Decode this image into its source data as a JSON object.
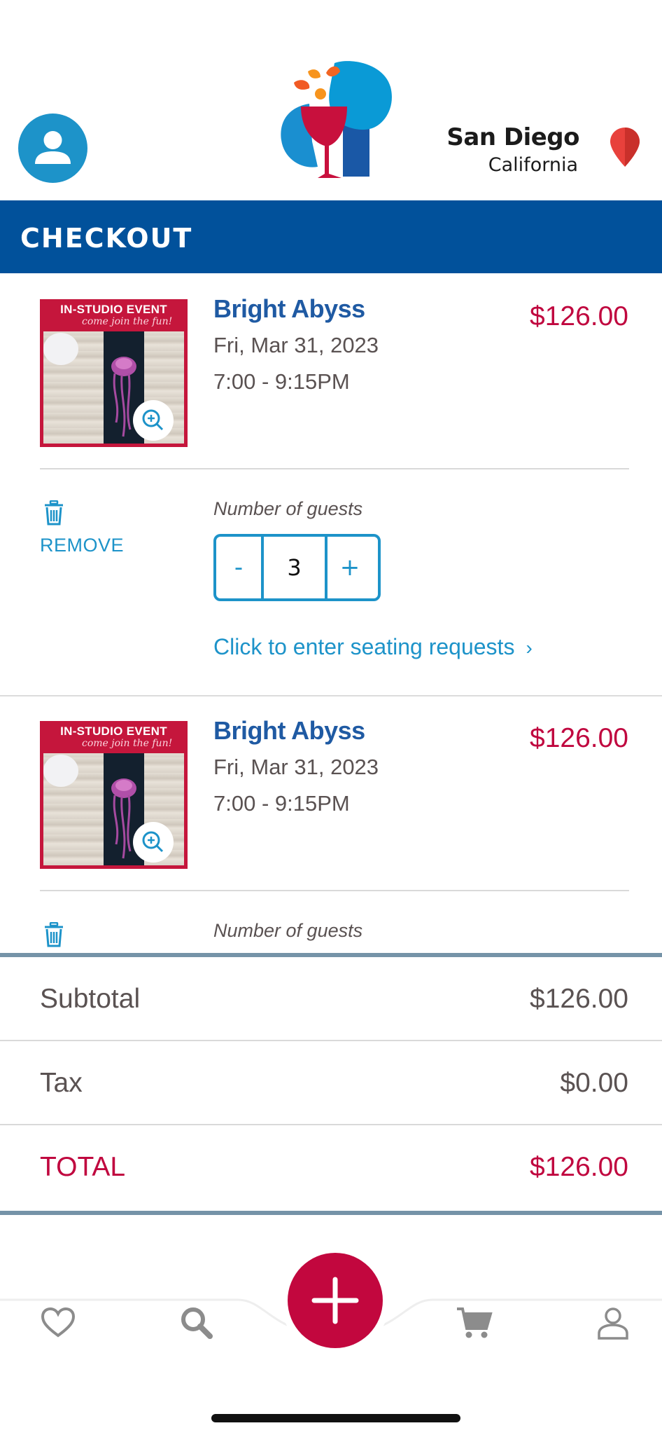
{
  "header": {
    "city": "San Diego",
    "state": "California"
  },
  "page": {
    "title": "CHECKOUT"
  },
  "cart": {
    "items": [
      {
        "thumb_headline": "IN-STUDIO EVENT",
        "thumb_tagline": "come join the fun!",
        "title": "Bright Abyss",
        "date": "Fri, Mar 31, 2023",
        "time": "7:00 - 9:15PM",
        "price": "$126.00",
        "remove_label": "REMOVE",
        "guests_label": "Number of guests",
        "guests": "3",
        "minus_label": "-",
        "plus_label": "+",
        "seating_link": "Click to enter seating requests",
        "seating_chevron": "›"
      },
      {
        "thumb_headline": "IN-STUDIO EVENT",
        "thumb_tagline": "come join the fun!",
        "title": "Bright Abyss",
        "date": "Fri, Mar 31, 2023",
        "time": "7:00 - 9:15PM",
        "price": "$126.00",
        "guests_label": "Number of guests"
      }
    ]
  },
  "totals": {
    "subtotal_label": "Subtotal",
    "subtotal_value": "$126.00",
    "tax_label": "Tax",
    "tax_value": "$0.00",
    "total_label": "TOTAL",
    "total_value": "$126.00"
  },
  "nav": {
    "items": [
      "heart-icon",
      "search-icon",
      "add-icon",
      "cart-icon",
      "profile-icon"
    ]
  },
  "colors": {
    "brand_blue": "#01519b",
    "accent_blue": "#1d93c9",
    "price_red": "#c0073f",
    "divider_steel": "#7593a8"
  }
}
